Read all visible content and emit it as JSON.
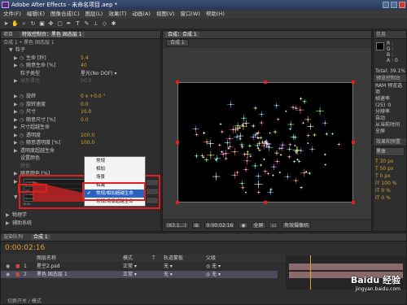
{
  "app": {
    "title": "Adobe After Effects - 未命名项目.aep *"
  },
  "menu": [
    "文件(F)",
    "编辑(E)",
    "图像合成(C)",
    "图层(L)",
    "效果(T)",
    "动画(A)",
    "视图(V)",
    "窗口(W)",
    "帮助(H)"
  ],
  "left_panel": {
    "tabs": [
      "项目",
      "特效控制台：黑色 固态层 1"
    ],
    "breadcrumb": "合成 1 • 黑色 固态层 1",
    "rows": [
      {
        "label": "粒子",
        "indent": 1,
        "tri": "▼"
      },
      {
        "label": "生命 [秒]",
        "indent": 2,
        "tri": "▶",
        "value": "5.4",
        "stopwatch": true
      },
      {
        "label": "随意生命 [%]",
        "indent": 2,
        "tri": "▶",
        "value": "40",
        "stopwatch": true
      },
      {
        "label": "粒子类型",
        "indent": 2,
        "value": "星光(No DOF)",
        "dropdown": true
      },
      {
        "label": "球形柔化",
        "indent": 2,
        "tri": "▶",
        "value": "50.0",
        "dim": true
      },
      {
        "label": "",
        "indent": 2
      },
      {
        "label": "旋转",
        "indent": 2,
        "tri": "▶",
        "value": "0 x +0.0 °",
        "stopwatch": true
      },
      {
        "label": "旋转速度",
        "indent": 2,
        "tri": "▶",
        "value": "0.0",
        "stopwatch": true
      },
      {
        "label": "尺寸",
        "indent": 2,
        "tri": "▶",
        "value": "10.0",
        "stopwatch": true
      },
      {
        "label": "随意尺寸 [%]",
        "indent": 2,
        "tri": "▶",
        "value": "0.0",
        "stopwatch": true
      },
      {
        "label": "尺寸超越生命",
        "indent": 2,
        "tri": "▶"
      },
      {
        "label": "透明度",
        "indent": 2,
        "tri": "▶",
        "value": "100.0",
        "stopwatch": true
      },
      {
        "label": "随意透明度 [%]",
        "indent": 2,
        "tri": "▶",
        "value": "100.0",
        "stopwatch": true
      },
      {
        "label": "透明度超越生命",
        "indent": 2,
        "tri": "▶"
      },
      {
        "label": "设置颜色",
        "indent": 2
      },
      {
        "label": "颜色",
        "indent": 2,
        "dim": true
      },
      {
        "label": "随意颜色 [%]",
        "indent": 2,
        "tri": "▶"
      },
      {
        "label": "颜色超越生命",
        "indent": 2,
        "tri": "▶"
      },
      {
        "label": "传递模式",
        "indent": 2,
        "highlight": true
      },
      {
        "label": "传递模式超越生命",
        "indent": 2,
        "tri": "▼"
      }
    ],
    "lower_rows": [
      {
        "label": "物理学",
        "tri": "▶"
      },
      {
        "label": "辅助系统",
        "tri": "▶"
      }
    ],
    "graph_left_labels": [
      "Adaptive",
      "Bright",
      "Add",
      "Screen",
      "Normal"
    ],
    "graph_axis_labels": [
      "Birth",
      "Death"
    ]
  },
  "dropdown": {
    "items": [
      "常规",
      "相加",
      "场景",
      "相减",
      "常规/相加超越生命",
      "常规/场景超越生命"
    ],
    "selected_index": 4,
    "checked_index": 4
  },
  "composition": {
    "tab": "合成：合成 1",
    "subtab": "合成 1",
    "zoom": "(63.1...)",
    "timecode": "0:00:02:16",
    "quality": "全屏",
    "active_cam": "有效摄像机"
  },
  "right_panel": {
    "info_tab": "信息",
    "info_lines": [
      "R :",
      "G :",
      "B :",
      "A : 0"
    ],
    "total": "Total: 39.1%",
    "preview_tab": "预览控制台",
    "ram_label": "RAM 预览选项",
    "fps_label": "帧速率",
    "fps_value": "(25)",
    "skip_label": "跳过",
    "skip_value": "0",
    "res_label": "分辨率",
    "res_value": "自动",
    "from_current": "从当前时间",
    "full_screen": "全屏",
    "effects_tab": "效果和预置",
    "char_label": "黑体",
    "sizes": [
      "30 px",
      "50 px",
      "0 px"
    ],
    "percents": [
      "100 %",
      "0 %",
      "0 %"
    ]
  },
  "timeline": {
    "tabs": [
      "渲染队列",
      "合成 1"
    ],
    "timecode": "0:00:02:16",
    "columns": [
      "图层名称",
      "模式",
      "T",
      "轨道蒙板",
      "父级"
    ],
    "layers": [
      {
        "num": "1",
        "name": "星空2.psd",
        "mode": "正常",
        "track": "无",
        "parent": "无",
        "color": "#c84848"
      },
      {
        "num": "2",
        "name": "黑色 固态层 1",
        "mode": "正常",
        "track": "无",
        "parent": "无",
        "color": "#c84848",
        "selected": true
      }
    ],
    "bottom": "切换开关 / 模式"
  },
  "watermark": {
    "text": "Baidu 经验",
    "url": "jingyan.baidu.com"
  }
}
